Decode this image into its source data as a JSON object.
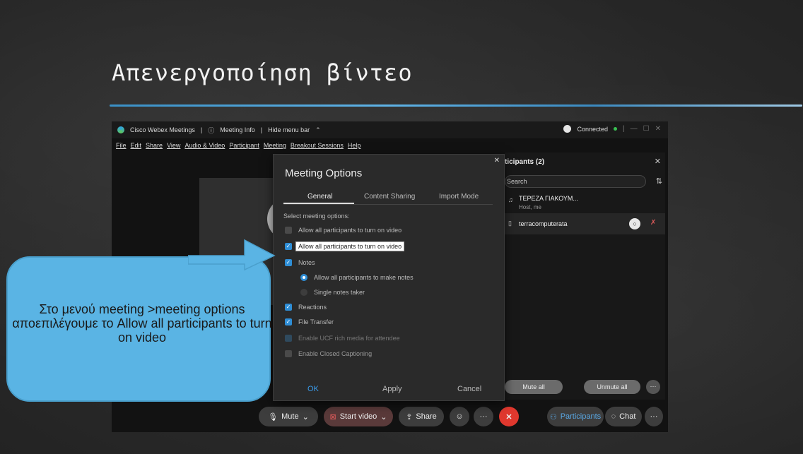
{
  "slide": {
    "title": "Απενεργοποίηση βίντεο",
    "accent_color": "#4aa3df"
  },
  "window": {
    "app_name": "Cisco Webex Meetings",
    "meeting_info": "Meeting Info",
    "hide_menu_bar": "Hide menu bar",
    "status": "Connected",
    "menu": [
      "File",
      "Edit",
      "Share",
      "View",
      "Audio & Video",
      "Participant",
      "Meeting",
      "Breakout Sessions",
      "Help"
    ]
  },
  "participants_panel": {
    "title": "ticipants (2)",
    "search_placeholder": "Search",
    "participants": [
      {
        "name": "ΤΕΡΕΖΑ ΓΙΑΚΟΥΜ...",
        "role": "Host, me"
      },
      {
        "name": "terracomputerata",
        "role": ""
      }
    ],
    "mute_all": "Mute all",
    "unmute_all": "Unmute all",
    "more": "···"
  },
  "meeting_options": {
    "title": "Meeting Options",
    "tabs": [
      "General",
      "Content Sharing",
      "Import Mode"
    ],
    "select_label": "Select meeting options:",
    "options": [
      {
        "label": "Allow all participants to turn on video",
        "checked": false
      },
      {
        "label": "Allow all participants to turn on video",
        "checked": true,
        "highlighted": true
      },
      {
        "label": "Notes",
        "checked": true
      },
      {
        "label": "Allow all participants to make notes",
        "type": "radio",
        "checked": true
      },
      {
        "label": "Single notes taker",
        "type": "radio",
        "checked": false
      },
      {
        "label": "Reactions",
        "checked": true
      },
      {
        "label": "File Transfer",
        "checked": true
      },
      {
        "label": "Enable UCF rich media for attendee",
        "checked": false
      },
      {
        "label": "Enable Closed Captioning",
        "checked": false
      }
    ],
    "ok": "OK",
    "apply": "Apply",
    "cancel": "Cancel"
  },
  "toolbar": {
    "mute": "Mute",
    "start_video": "Start video",
    "share": "Share",
    "participants": "Participants",
    "chat": "Chat"
  },
  "callout": {
    "text": "Στο μενού meeting >meeting options αποεπιλέγουμε το Allow all participants to turn on video",
    "fill_color": "#5ab4e4"
  }
}
